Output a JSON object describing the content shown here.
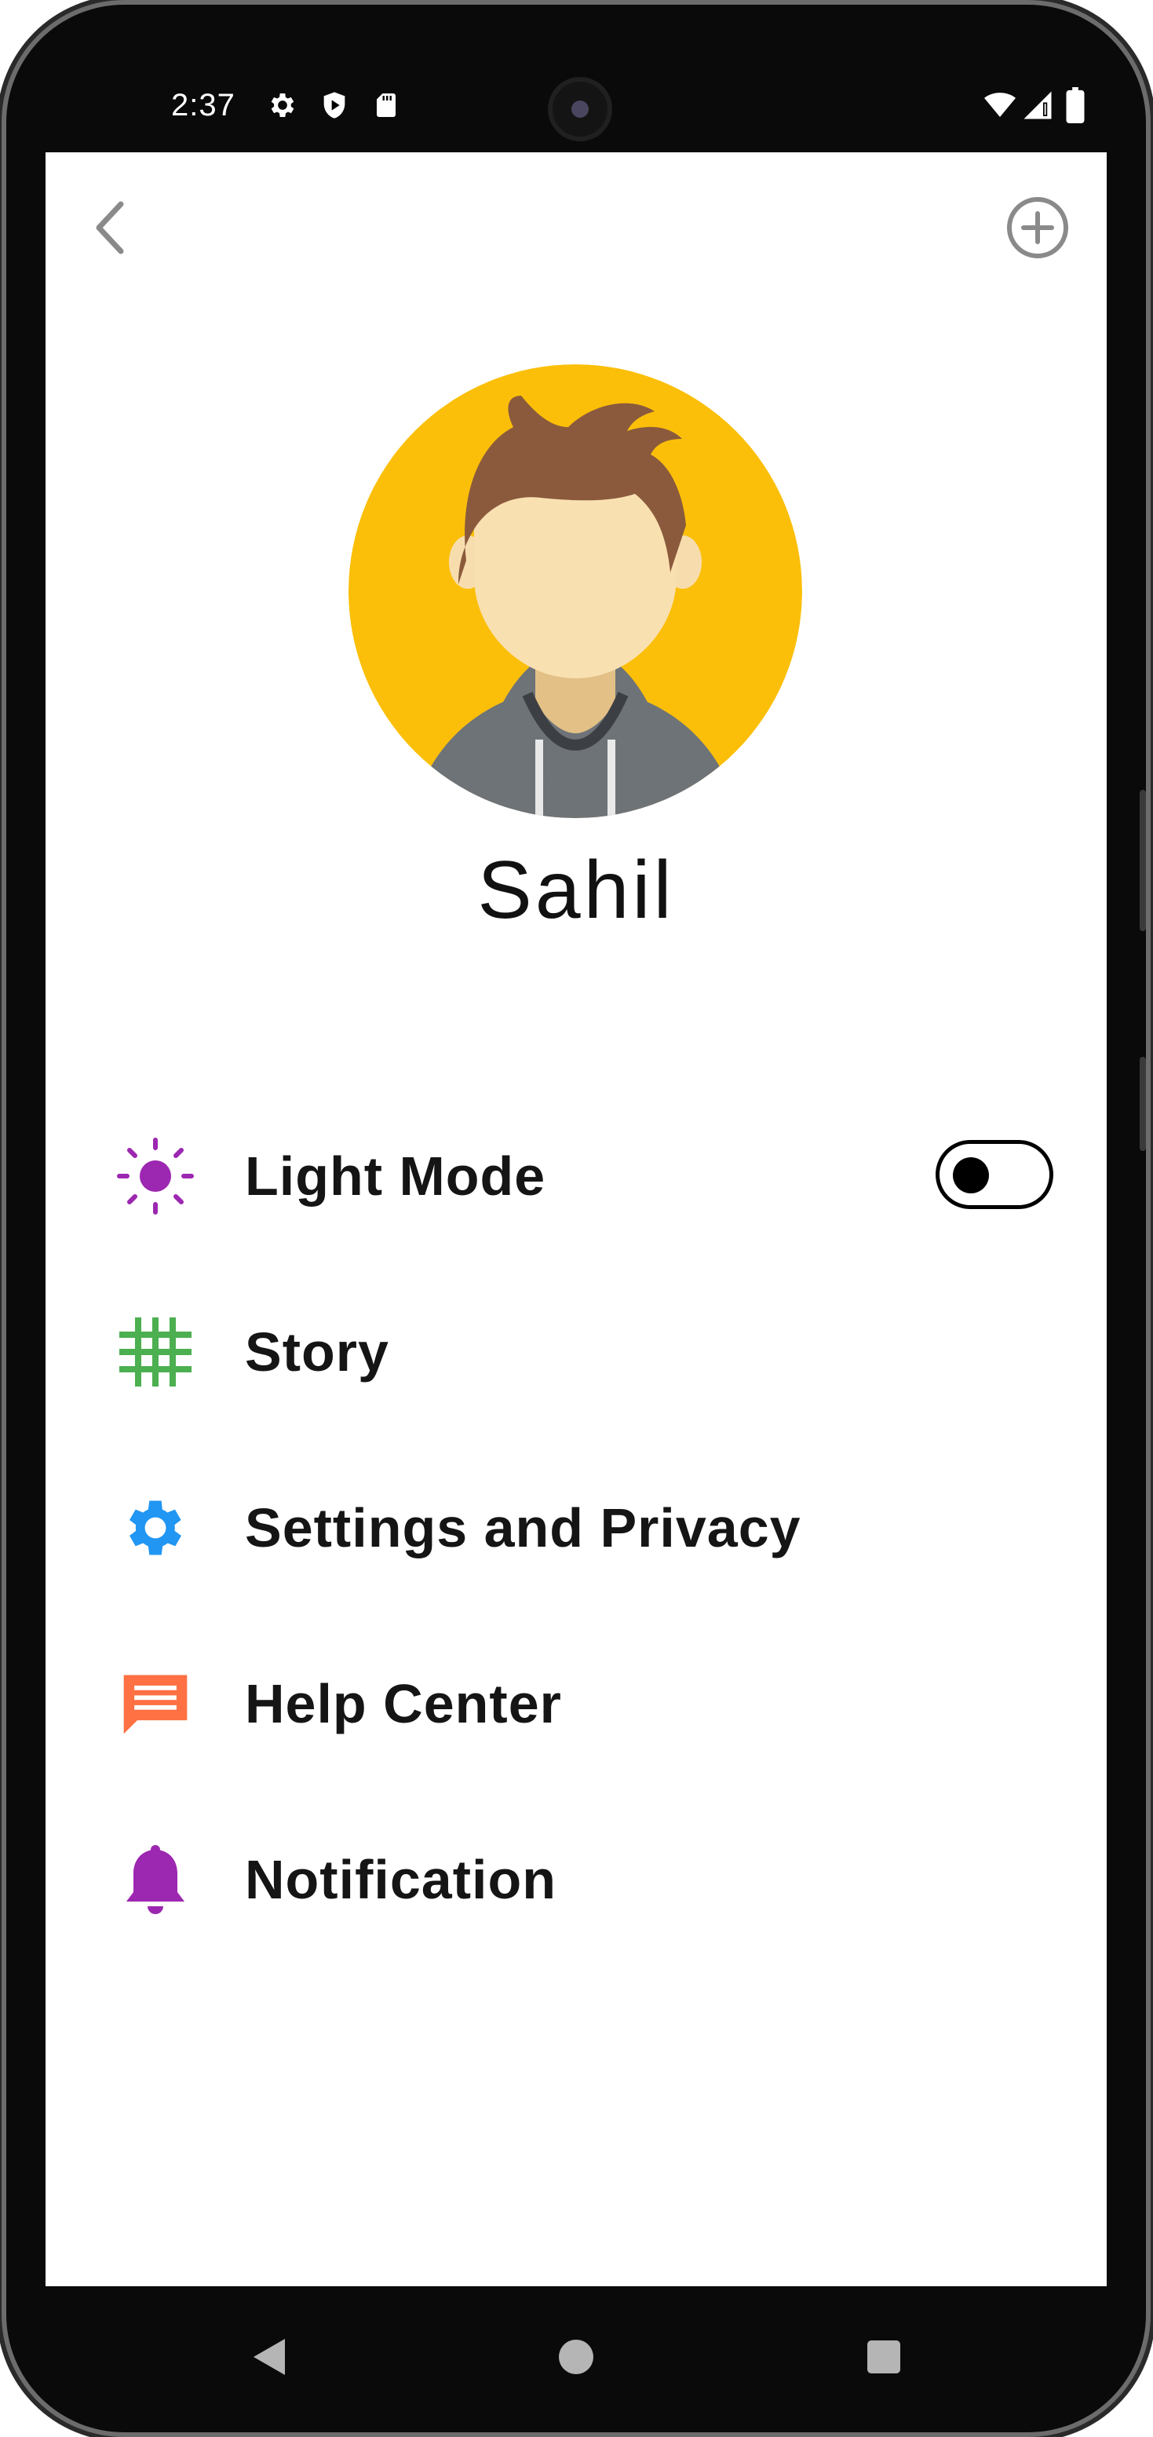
{
  "status_bar": {
    "time": "2:37",
    "left_icons": [
      "settings-icon",
      "shield-play-icon",
      "sd-card-icon"
    ],
    "right_icons": [
      "wifi-icon",
      "cellular-signal-icon",
      "battery-icon"
    ]
  },
  "header": {
    "back_icon": "chevron-left-icon",
    "add_icon": "plus-circle-icon"
  },
  "profile": {
    "name": "Sahil",
    "avatar_background": "#FBBF09"
  },
  "menu": {
    "items": [
      {
        "label": "Light Mode",
        "icon": "sun-icon",
        "icon_color": "#9C27B0",
        "toggle_on": false
      },
      {
        "label": "Story",
        "icon": "grid-icon",
        "icon_color": "#4CAF50"
      },
      {
        "label": "Settings and Privacy",
        "icon": "gear-icon",
        "icon_color": "#2196F3"
      },
      {
        "label": "Help Center",
        "icon": "chat-icon",
        "icon_color": "#FF7043"
      },
      {
        "label": "Notification",
        "icon": "bell-icon",
        "icon_color": "#9C27B0"
      }
    ]
  },
  "nav_bar": {
    "icons": [
      "back-triangle-icon",
      "home-circle-icon",
      "recents-square-icon"
    ]
  },
  "colors": {
    "screen_background": "#FFFFFF",
    "text": "#151515",
    "bezel": "#0A0A0A"
  }
}
